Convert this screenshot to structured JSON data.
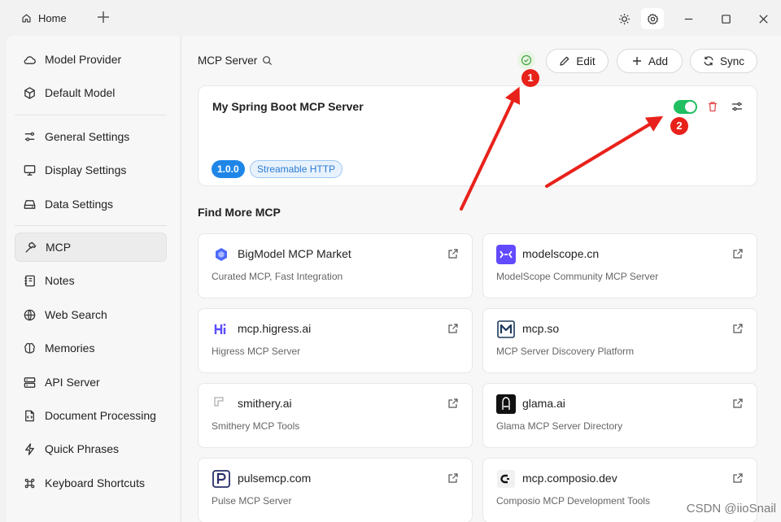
{
  "titlebar": {
    "home_tab": "Home",
    "icons": [
      "home-icon",
      "plus-icon",
      "sun-icon",
      "gear-icon",
      "minimize-icon",
      "maximize-icon",
      "close-icon"
    ]
  },
  "sidebar": {
    "items": [
      {
        "label": "Model Provider",
        "icon": "cloud-icon"
      },
      {
        "label": "Default Model",
        "icon": "cube-icon"
      },
      {
        "label": "General Settings",
        "icon": "sliders-icon"
      },
      {
        "label": "Display Settings",
        "icon": "monitor-icon"
      },
      {
        "label": "Data Settings",
        "icon": "drive-icon"
      },
      {
        "label": "MCP",
        "icon": "hammer-icon"
      },
      {
        "label": "Notes",
        "icon": "notebook-icon"
      },
      {
        "label": "Web Search",
        "icon": "globe-icon"
      },
      {
        "label": "Memories",
        "icon": "brain-icon"
      },
      {
        "label": "API Server",
        "icon": "server-icon"
      },
      {
        "label": "Document Processing",
        "icon": "file-code-icon"
      },
      {
        "label": "Quick Phrases",
        "icon": "zap-icon"
      },
      {
        "label": "Keyboard Shortcuts",
        "icon": "command-icon"
      }
    ],
    "active": "MCP"
  },
  "main": {
    "title": "MCP Server",
    "edit_label": "Edit",
    "add_label": "Add",
    "sync_label": "Sync",
    "server": {
      "name": "My Spring Boot MCP Server",
      "enabled": true,
      "version": "1.0.0",
      "transport": "Streamable HTTP"
    },
    "find_more_title": "Find More MCP",
    "markets": [
      {
        "name": "BigModel MCP Market",
        "desc": "Curated MCP, Fast Integration",
        "icon": "bigmodel-logo"
      },
      {
        "name": "modelscope.cn",
        "desc": "ModelScope Community MCP Server",
        "icon": "modelscope-logo"
      },
      {
        "name": "mcp.higress.ai",
        "desc": "Higress MCP Server",
        "icon": "higress-logo"
      },
      {
        "name": "mcp.so",
        "desc": "MCP Server Discovery Platform",
        "icon": "mcpso-logo"
      },
      {
        "name": "smithery.ai",
        "desc": "Smithery MCP Tools",
        "icon": "broken-image-icon"
      },
      {
        "name": "glama.ai",
        "desc": "Glama MCP Server Directory",
        "icon": "glama-logo"
      },
      {
        "name": "pulsemcp.com",
        "desc": "Pulse MCP Server",
        "icon": "pulse-logo"
      },
      {
        "name": "mcp.composio.dev",
        "desc": "Composio MCP Development Tools",
        "icon": "composio-logo"
      }
    ]
  },
  "annotations": {
    "marker_1": "1",
    "marker_2": "2",
    "color": "#e8221b"
  },
  "watermark": "CSDN @iioSnail",
  "colors": {
    "toggle_on": "#1fbf62",
    "version_badge": "#1f86e8",
    "delete": "#e5484d"
  }
}
